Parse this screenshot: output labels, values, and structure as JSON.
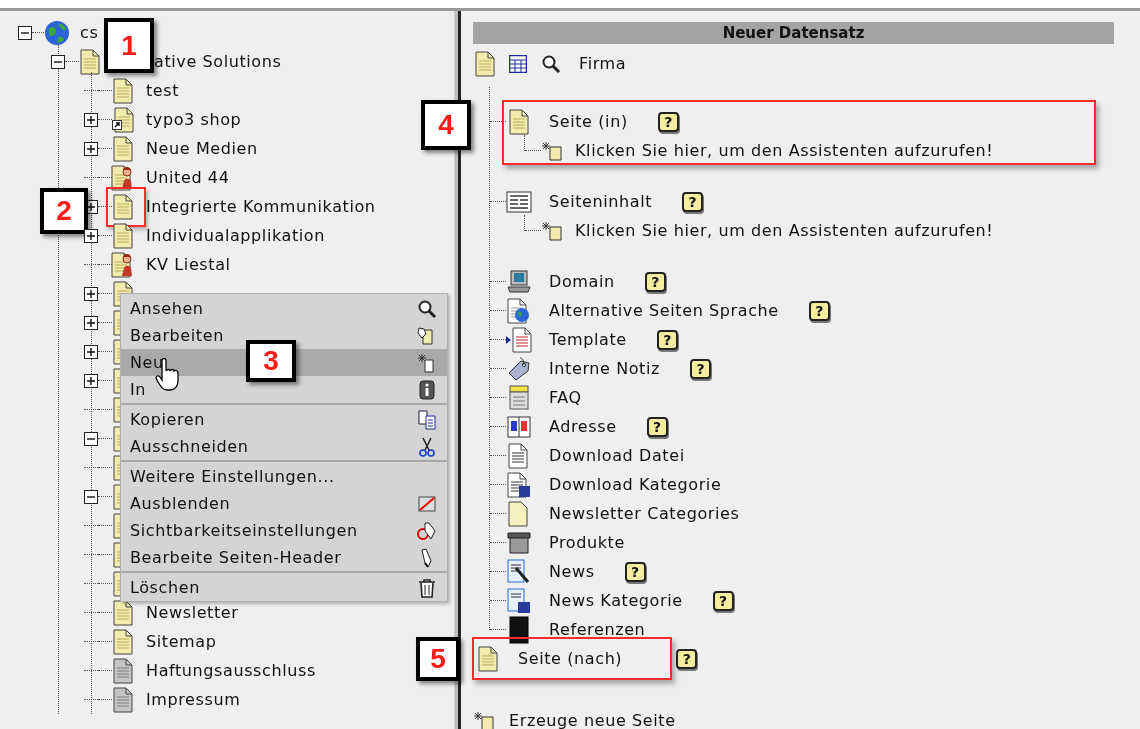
{
  "tree": {
    "root": {
      "label": "cs",
      "kind": "globe",
      "expanded": true,
      "children": [
        {
          "label": "ative Solutions",
          "kind": "page",
          "expanded": true,
          "callout": "1",
          "children": [
            {
              "label": "test",
              "kind": "page"
            },
            {
              "label": "typo3 shop",
              "kind": "shortcut",
              "expanded": false
            },
            {
              "label": "Neue Medien",
              "kind": "page",
              "expanded": false
            },
            {
              "label": "United 44",
              "kind": "user"
            },
            {
              "label": "Integrierte Kommunikation",
              "kind": "page",
              "expanded": false,
              "highlighted": true,
              "callout": "2"
            },
            {
              "label": "Individualapplikation",
              "kind": "page",
              "expanded": false
            },
            {
              "label": "KV Liestal",
              "kind": "user"
            },
            {
              "kind": "page",
              "expanded": false
            },
            {
              "kind": "page",
              "expanded": false
            },
            {
              "kind": "page",
              "expanded": false
            },
            {
              "kind": "page",
              "expanded": false
            },
            {
              "kind": "page"
            },
            {
              "kind": "page",
              "expanded": true
            },
            {
              "kind": "page"
            },
            {
              "kind": "page",
              "expanded": true
            },
            {
              "kind": "page"
            },
            {
              "kind": "page"
            },
            {
              "kind": "page"
            },
            {
              "label": "Newsletter",
              "kind": "page"
            },
            {
              "label": "Sitemap",
              "kind": "page"
            },
            {
              "label": "Haftungsausschluss",
              "kind": "gray"
            },
            {
              "label": "Impressum",
              "kind": "gray"
            }
          ]
        }
      ]
    }
  },
  "context_menu": {
    "groups": [
      [
        {
          "label": "Ansehen",
          "hovered": false
        },
        {
          "label": "Bearbeiten",
          "hovered": false
        },
        {
          "label": "Neu",
          "hovered": true,
          "callout": "3"
        },
        {
          "label": "In",
          "hovered": false
        }
      ],
      [
        {
          "label": "Kopieren",
          "hovered": false
        },
        {
          "label": "Ausschneiden",
          "hovered": false
        }
      ],
      [
        {
          "label": "Weitere Einstellungen...",
          "hovered": false
        },
        {
          "label": "Ausblenden",
          "hovered": false
        },
        {
          "label": "Sichtbarkeitseinstellungen",
          "hovered": false
        },
        {
          "label": "Bearbeite Seiten-Header",
          "hovered": false
        }
      ],
      [
        {
          "label": "Löschen",
          "hovered": false
        }
      ]
    ]
  },
  "panel": {
    "title": "Neuer Datensatz",
    "record": {
      "label": "Firma"
    },
    "tables": [
      {
        "label": "Seite (in)",
        "help": "?",
        "highlighted": true,
        "callout": "4",
        "wizard": "Klicken Sie hier, um den Assistenten aufzurufen!"
      },
      {
        "label": "Seiteninhalt",
        "help": "?",
        "wizard": "Klicken Sie hier, um den Assistenten aufzurufen!"
      },
      {
        "label": "Domain",
        "help": "?"
      },
      {
        "label": "Alternative Seiten Sprache",
        "help": "?"
      },
      {
        "label": "Template",
        "help": "?"
      },
      {
        "label": "Interne Notiz",
        "help": "?"
      },
      {
        "label": "FAQ"
      },
      {
        "label": "Adresse",
        "help": "?"
      },
      {
        "label": "Download Datei"
      },
      {
        "label": "Download Kategorie"
      },
      {
        "label": "Newsletter Categories"
      },
      {
        "label": "Produkte"
      },
      {
        "label": "News",
        "help": "?"
      },
      {
        "label": "News Kategorie",
        "help": "?"
      },
      {
        "label": "Referenzen"
      }
    ],
    "after": {
      "label": "Seite (nach)",
      "help": "?",
      "highlighted": true,
      "callout": "5"
    },
    "create_link": "Erzeuge neue Seite"
  }
}
